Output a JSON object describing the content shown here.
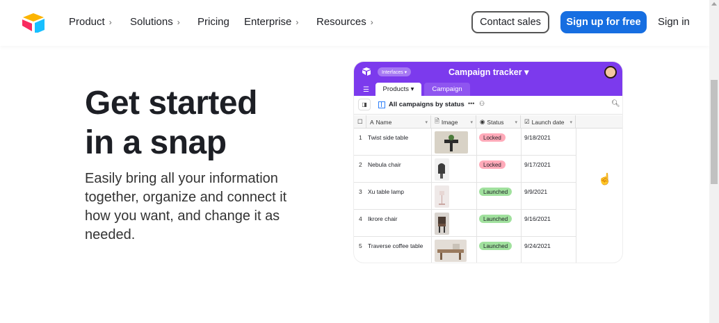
{
  "nav": {
    "items": [
      {
        "label": "Product",
        "has_chevron": true
      },
      {
        "label": "Solutions",
        "has_chevron": true
      },
      {
        "label": "Pricing",
        "has_chevron": false
      },
      {
        "label": "Enterprise",
        "has_chevron": true
      },
      {
        "label": "Resources",
        "has_chevron": true
      }
    ],
    "contact_label": "Contact sales",
    "signup_label": "Sign up for free",
    "signin_label": "Sign in",
    "chevron": "›"
  },
  "hero": {
    "headline_line1": "Get started",
    "headline_line2": "in a snap",
    "subtext": "Easily bring all your information together, organize and connect it how you want, and change it as needed."
  },
  "mock": {
    "interfaces_label": "Interfaces ▾",
    "title": "Campaign tracker ▾",
    "tabs": [
      {
        "label": "Products ▾",
        "active": true
      },
      {
        "label": "Campaign",
        "active": false
      }
    ],
    "view_name": "All campaigns by status",
    "columns": [
      {
        "label": "Name",
        "icon": "A"
      },
      {
        "label": "Image",
        "icon": "🗎"
      },
      {
        "label": "Status",
        "icon": "◉"
      },
      {
        "label": "Launch date",
        "icon": "☑"
      }
    ],
    "rows": [
      {
        "num": "1",
        "name": "Twist side table",
        "status": "Locked",
        "date": "9/18/2021"
      },
      {
        "num": "2",
        "name": "Nebula chair",
        "status": "Locked",
        "date": "9/17/2021"
      },
      {
        "num": "3",
        "name": "Xu table lamp",
        "status": "Launched",
        "date": "9/9/2021"
      },
      {
        "num": "4",
        "name": "Ikrore chair",
        "status": "Launched",
        "date": "9/16/2021"
      },
      {
        "num": "5",
        "name": "Traverse coffee table",
        "status": "Launched",
        "date": "9/24/2021"
      }
    ]
  },
  "colors": {
    "brand_blue": "#166ee1",
    "mock_purple": "#7c3aed",
    "badge_locked": "#ffaab9",
    "badge_launched": "#a1e19e"
  }
}
